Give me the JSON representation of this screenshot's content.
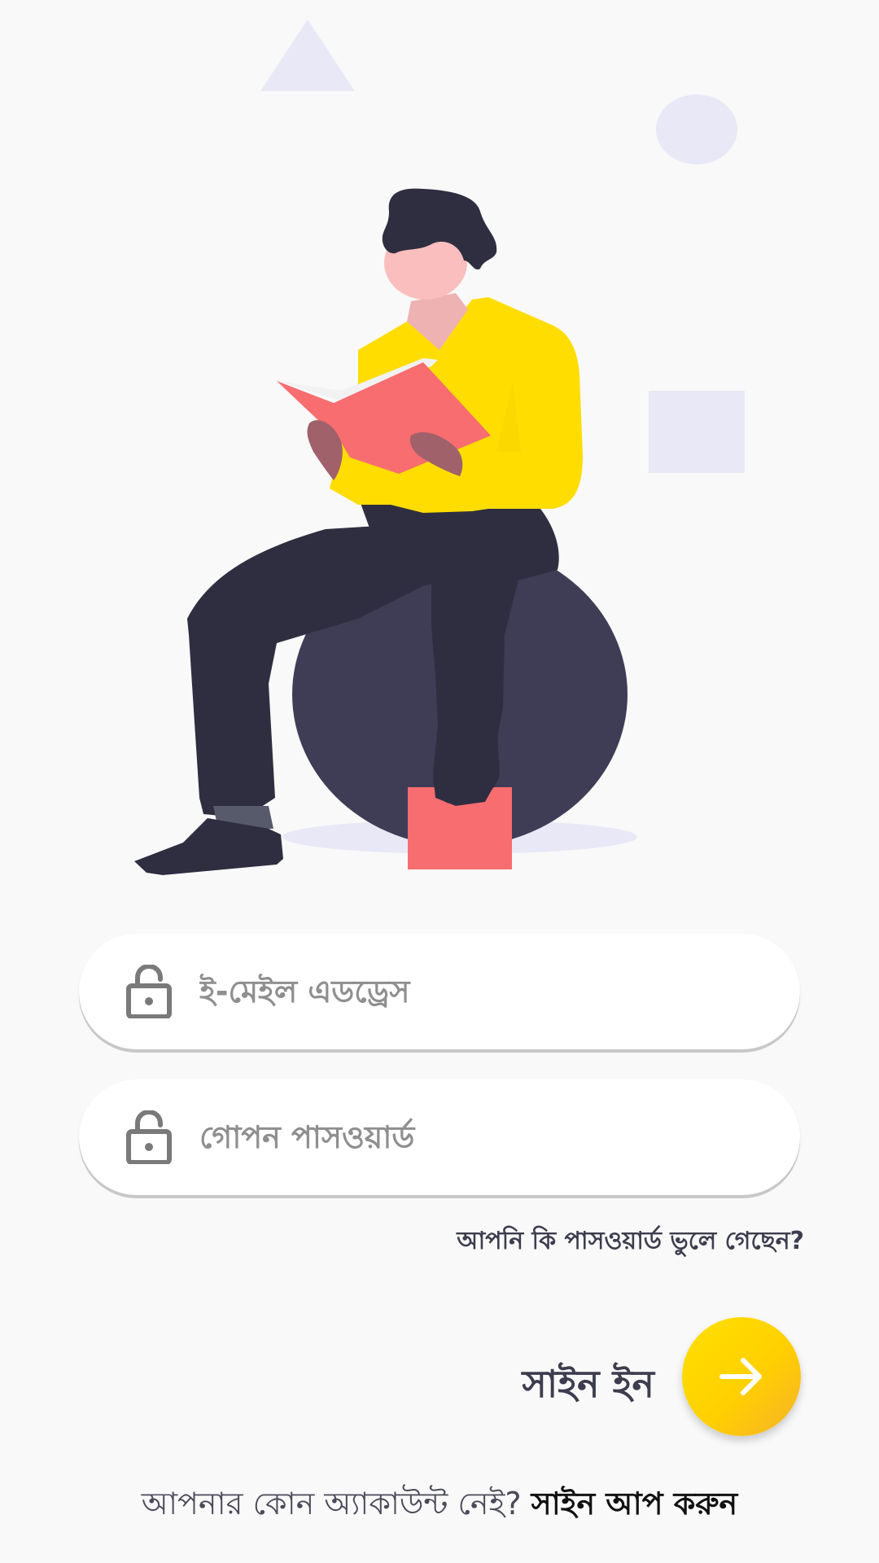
{
  "login_form": {
    "email_placeholder": "ই-মেইল এডড্রেস",
    "password_placeholder": "গোপন পাসওয়ার্ড",
    "forgot_password_link": "আপনি কি পাসওয়ার্ড ভুলে গেছেন?",
    "sign_in_label": "সাইন ইন",
    "sign_in_button_icon": "arrow-right-icon",
    "field_icon": "lock-icon"
  },
  "signup": {
    "prompt": "আপনার কোন অ্যাকাউন্ট নেই?",
    "link": "সাইন আপ করুন"
  },
  "colors": {
    "background": "#f9f9f9",
    "accent_yellow": "#ffdd00",
    "text_dark": "#3d3d4f",
    "placeholder_gray": "#8f8f8f"
  },
  "illustration": {
    "subject": "person-reading-book-on-ball"
  }
}
